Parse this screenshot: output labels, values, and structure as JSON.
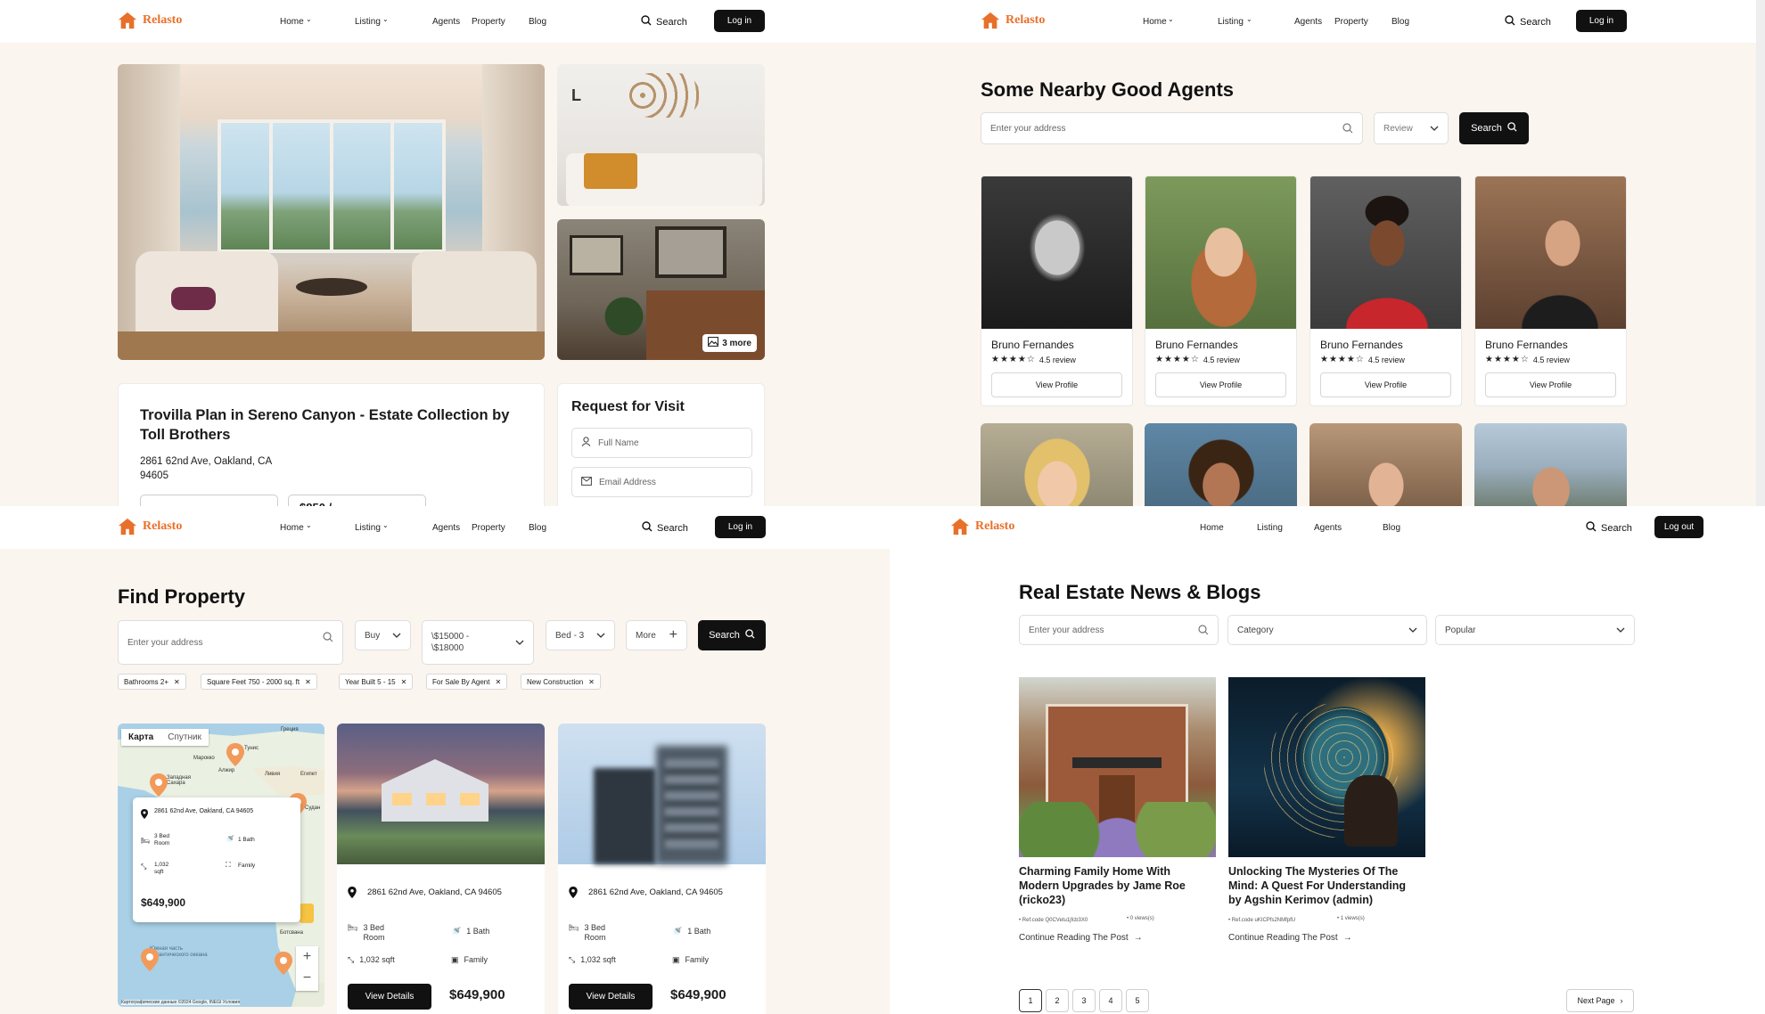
{
  "brand": {
    "name": "Relasto",
    "color": "#e8702a"
  },
  "nav1": {
    "links": [
      "Home",
      "Listing",
      "Agents",
      "Property",
      "Blog"
    ],
    "search": "Search",
    "button": "Log in"
  },
  "nav4": {
    "links": [
      "Home",
      "Listing",
      "Agents",
      "Blog"
    ],
    "search": "Search",
    "button": "Log out"
  },
  "detail": {
    "more_photos": "3 more",
    "title": "Trovilla Plan in Sereno Canyon - Estate Collection by Toll Brothers",
    "address": "2861 62nd Ave, Oakland, CA 94605",
    "price_peek": "$850 /",
    "visit": {
      "title": "Request for Visit",
      "name_placeholder": "Full Name",
      "email_placeholder": "Email Address"
    }
  },
  "agents": {
    "title": "Some Nearby Good Agents",
    "search_placeholder": "Enter your address",
    "filter": "Review",
    "search_button": "Search",
    "cards": [
      {
        "name": "Bruno Fernandes",
        "rating": "4.5 review",
        "stars": "★★★★☆",
        "button": "View Profile"
      },
      {
        "name": "Bruno Fernandes",
        "rating": "4.5 review",
        "stars": "★★★★☆",
        "button": "View Profile"
      },
      {
        "name": "Bruno Fernandes",
        "rating": "4.5 review",
        "stars": "★★★★☆",
        "button": "View Profile"
      },
      {
        "name": "Bruno Fernandes",
        "rating": "4.5 review",
        "stars": "★★★★☆",
        "button": "View Profile"
      }
    ]
  },
  "find": {
    "title": "Find Property",
    "search_placeholder": "Enter your address",
    "type": "Buy",
    "price": "\\$15000 - \\$18000",
    "bed": "Bed - 3",
    "more": "More",
    "search_button": "Search",
    "chips": [
      "Bathrooms 2+",
      "Square Feet 750 - 2000 sq. ft",
      "Year Built 5 - 15",
      "For Sale By Agent",
      "New Construction"
    ],
    "map": {
      "tabs": [
        "Карта",
        "Спутник"
      ],
      "labels": [
        "Греция",
        "Тунис",
        "Марокко",
        "Алжир",
        "Ливия",
        "Египет",
        "Западная Сахара",
        "Судан",
        "Ботсвана",
        "Южная часть Атлантического океана"
      ],
      "attribution": "Картографические данные ©2024 Google, INEGI  Условия",
      "popup": {
        "address": "2861 62nd Ave, Oakland, CA 94605",
        "bed": "3 Bed Room",
        "bath": "1 Bath",
        "area": "1,032 sqft",
        "type": "Family",
        "price": "$649,900"
      }
    },
    "listings": [
      {
        "address": "2861 62nd Ave, Oakland, CA 94605",
        "bed": "3 Bed Room",
        "bath": "1 Bath",
        "area": "1,032 sqft",
        "type": "Family",
        "button": "View Details",
        "price": "$649,900"
      },
      {
        "address": "2861 62nd Ave, Oakland, CA 94605",
        "bed": "3 Bed Room",
        "bath": "1 Bath",
        "area": "1,032 sqft",
        "type": "Family",
        "button": "View Details",
        "price": "$649,900"
      }
    ]
  },
  "blog": {
    "title": "Real Estate News & Blogs",
    "search_placeholder": "Enter your address",
    "category": "Category",
    "sort": "Popular",
    "posts": [
      {
        "title": "Charming Family Home With Modern Upgrades by Jame Roe (ricko23)",
        "ref": "Ref.code Q0CVetu1jfcb3X0",
        "views": "0 views(s)",
        "link": "Continue Reading The Post"
      },
      {
        "title": "Unlocking The Mysteries Of The Mind: A Quest For Understanding by Agshin Kerimov (admin)",
        "ref": "Ref.code uKICPfs2NMfpfU",
        "views": "1 views(s)",
        "link": "Continue Reading The Post"
      }
    ],
    "pages": [
      "1",
      "2",
      "3",
      "4",
      "5"
    ],
    "next": "Next Page"
  },
  "colors": {
    "accent": "#e8702a",
    "dark": "#111111",
    "bg": "#fbf5ef"
  }
}
